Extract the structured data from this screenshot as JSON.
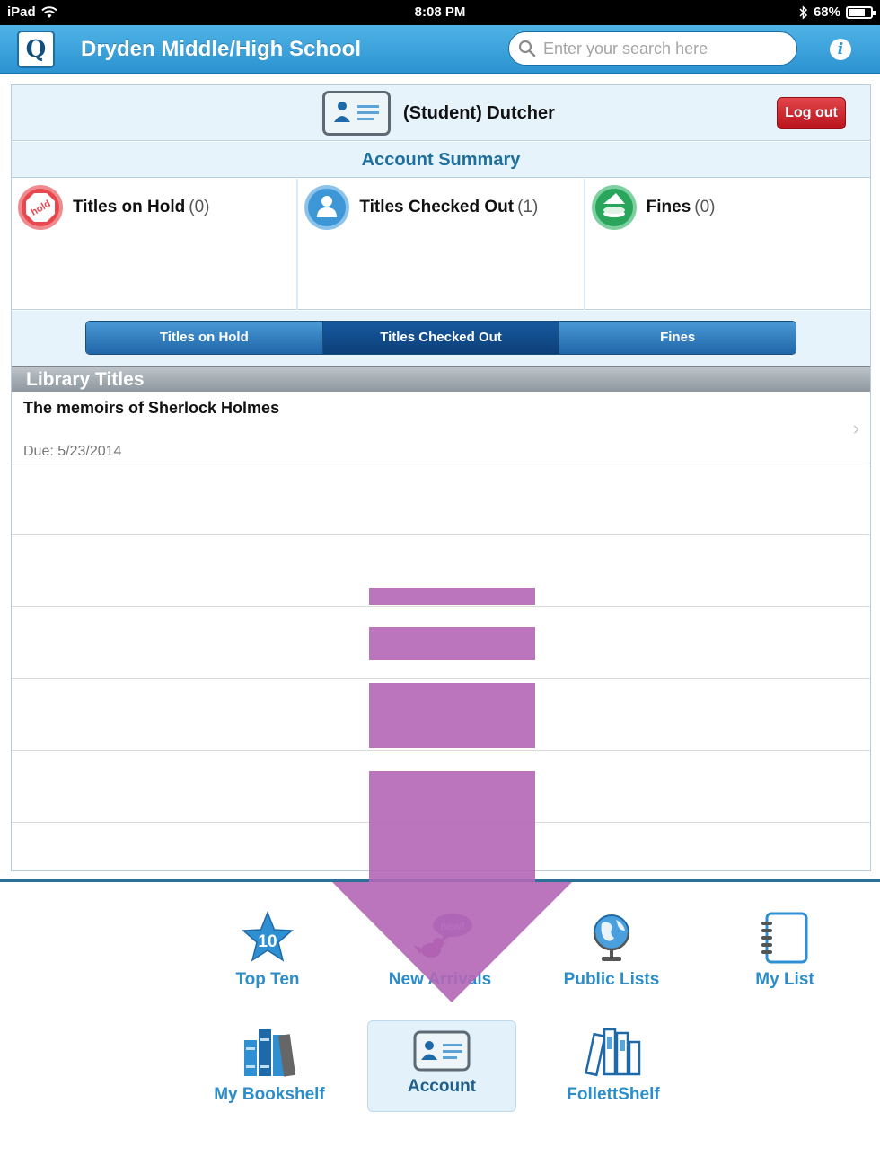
{
  "status_bar": {
    "device": "iPad",
    "time": "8:08 PM",
    "battery": "68%"
  },
  "header": {
    "logo_letter": "Q",
    "title": "Dryden Middle/High School",
    "search_placeholder": "Enter your search here"
  },
  "account": {
    "user_name": "(Student) Dutcher",
    "logout_label": "Log out",
    "summary_title": "Account Summary",
    "summary": [
      {
        "label": "Titles on Hold",
        "count": "(0)",
        "icon": "hold-icon",
        "badge_text": "hold",
        "color": "#e8474e"
      },
      {
        "label": "Titles Checked Out",
        "count": "(1)",
        "icon": "person-icon",
        "color": "#3d96d6"
      },
      {
        "label": "Fines",
        "count": "(0)",
        "icon": "fines-icon",
        "color": "#2aa55c"
      }
    ],
    "tabs": [
      {
        "label": "Titles on Hold",
        "active": false
      },
      {
        "label": "Titles Checked Out",
        "active": true
      },
      {
        "label": "Fines",
        "active": false
      }
    ],
    "section_title": "Library Titles",
    "items": [
      {
        "title": "The memoirs of Sherlock Holmes",
        "due": "Due: 5/23/2014"
      }
    ]
  },
  "bottom_nav": [
    {
      "label": "Top Ten",
      "icon": "star-icon",
      "badge": "10",
      "selected": false
    },
    {
      "label": "New Arrivals",
      "icon": "bird-icon",
      "badge": "new!",
      "selected": false
    },
    {
      "label": "Public Lists",
      "icon": "globe-icon",
      "selected": false
    },
    {
      "label": "My List",
      "icon": "notebook-icon",
      "selected": false
    },
    {
      "label": "My Bookshelf",
      "icon": "books-icon",
      "selected": false
    },
    {
      "label": "Account",
      "icon": "id-card-icon",
      "selected": true
    },
    {
      "label": "FollettShelf",
      "icon": "ebooks-icon",
      "selected": false
    }
  ],
  "colors": {
    "header": "#2c93d1",
    "accent": "#2b8dcc",
    "logout": "#c81e26",
    "overlay": "#b266b6"
  }
}
